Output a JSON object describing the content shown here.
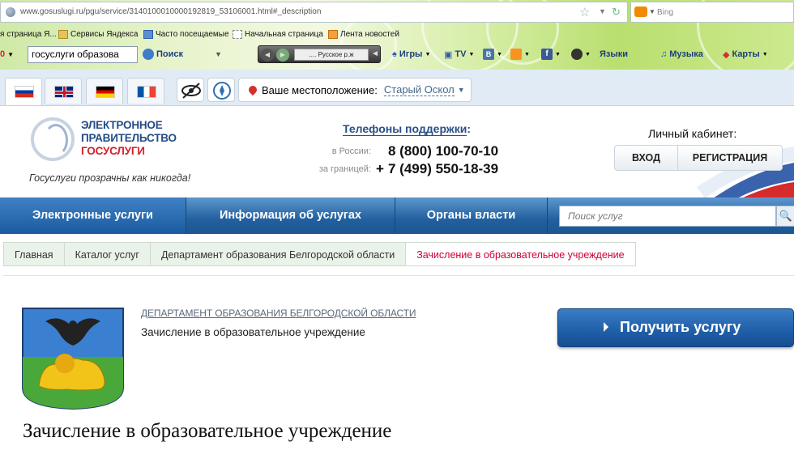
{
  "browser": {
    "url": "www.gosuslugi.ru/pgu/service/3140100010000192819_53106001.html#_description",
    "search_engine": "Bing",
    "bookmarks": [
      {
        "label": "я страница Я...",
        "icon": "yandex-page-icon"
      },
      {
        "label": "Сервисы Яндекса",
        "icon": "folder-icon"
      },
      {
        "label": "Часто посещаемые",
        "icon": "history-icon"
      },
      {
        "label": "Начальная страница",
        "icon": "page-icon"
      },
      {
        "label": "Лента новостей",
        "icon": "rss-icon"
      }
    ],
    "toolbar": {
      "search_value": "госуслуги образова",
      "search_button": "Поиск",
      "radio_text": ".... Русское р.ж",
      "games": "Игры",
      "tv": "TV",
      "lang": "Языки",
      "music": "Музыка",
      "maps": "Карты"
    }
  },
  "site": {
    "location_label": "Ваше местоположение:",
    "location_value": "Старый Оскол",
    "logo_line1": "ЭЛЕКТРОННОЕ",
    "logo_line2": "ПРАВИТЕЛЬСТВО",
    "logo_line3": "ГОСУСЛУГИ",
    "slogan": "Госуслуги прозрачны как никогда!",
    "support_title": "Телефоны поддержки",
    "support_colon": ":",
    "phones": [
      {
        "label": "в России:",
        "prefix": "",
        "number": "8 (800) 100-70-10"
      },
      {
        "label": "за границей:",
        "prefix": "+",
        "number": "7 (499) 550-18-39"
      }
    ],
    "cabinet_title": "Личный кабинет:",
    "login": "ВХОД",
    "register": "РЕГИСТРАЦИЯ",
    "nav": [
      "Электронные услуги",
      "Информация об услугах",
      "Органы власти"
    ],
    "search_placeholder": "Поиск услуг",
    "breadcrumbs": [
      "Главная",
      "Каталог услуг",
      "Департамент образования Белгородской области",
      "Зачисление в образовательное учреждение"
    ],
    "department": "ДЕПАРТАМЕНТ ОБРАЗОВАНИЯ БЕЛГОРОДСКОЙ ОБЛАСТИ",
    "service_name": "Зачисление в образовательное учреждение",
    "get_service": "Получить услугу",
    "page_title": "Зачисление в образовательное учреждение"
  },
  "colors": {
    "brand_blue": "#244c86",
    "brand_red": "#d3202a",
    "nav_blue": "#23609e",
    "crumb_active": "#cc0033"
  }
}
